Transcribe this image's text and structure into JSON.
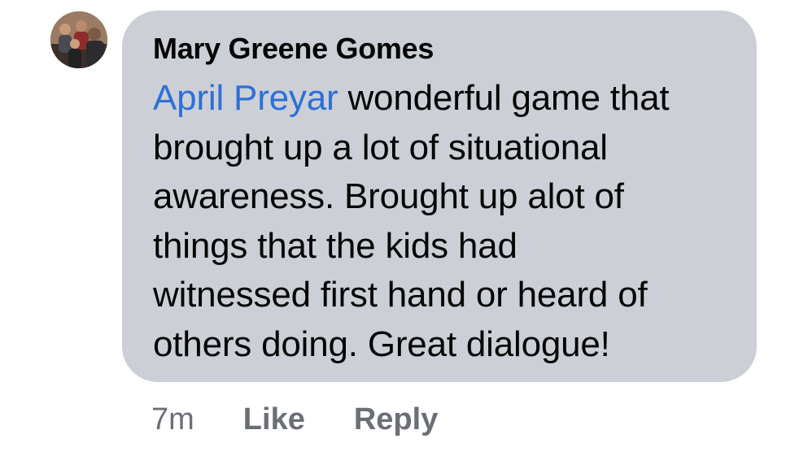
{
  "comment": {
    "author": "Mary Greene Gomes",
    "mention": "April Preyar",
    "text_lines": [
      " wonderful game that",
      "brought up a lot of situational",
      "awareness. Brought up alot of",
      "things that the kids had",
      "witnessed first hand or heard of",
      "others doing. Great dialogue!"
    ],
    "avatar_icon": "profile-photo-group",
    "colors": {
      "bubble": "#ccd0d6",
      "mention": "#2e6fd8",
      "meta": "#6b6f75"
    }
  },
  "actions": {
    "timestamp": "7m",
    "like_label": "Like",
    "reply_label": "Reply"
  }
}
